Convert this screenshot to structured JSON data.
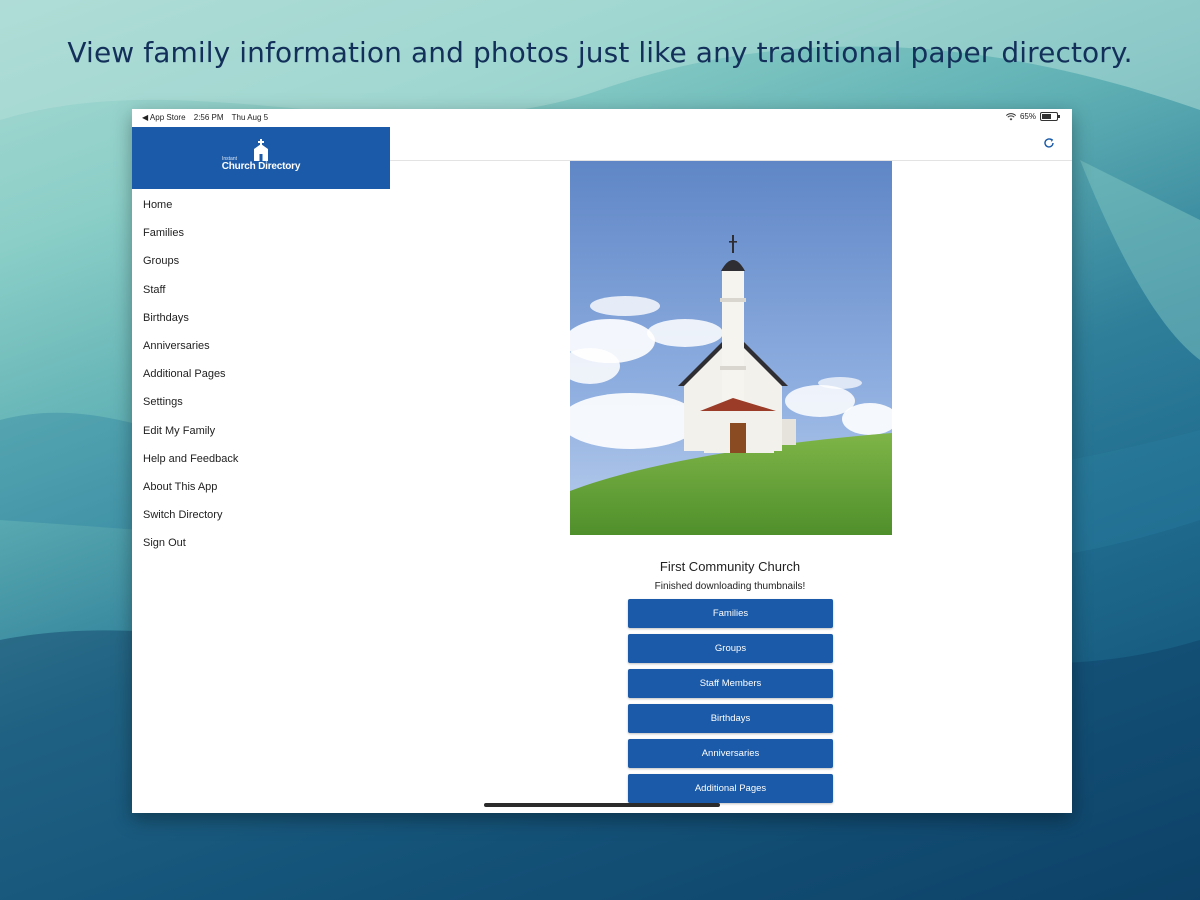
{
  "headline": "View family information and photos just like any traditional paper directory.",
  "status_bar": {
    "back_app": "◀ App Store",
    "time": "2:56 PM",
    "date": "Thu Aug 5",
    "battery": "65%"
  },
  "brand": {
    "top_text": "Instant",
    "name": "Church Directory"
  },
  "menu": [
    {
      "label": "Home"
    },
    {
      "label": "Families"
    },
    {
      "label": "Groups"
    },
    {
      "label": "Staff"
    },
    {
      "label": "Birthdays"
    },
    {
      "label": "Anniversaries"
    },
    {
      "label": "Additional Pages"
    },
    {
      "label": "Settings"
    },
    {
      "label": "Edit My Family"
    },
    {
      "label": "Help and Feedback"
    },
    {
      "label": "About This App"
    },
    {
      "label": "Switch Directory"
    },
    {
      "label": "Sign Out"
    }
  ],
  "main": {
    "church_name": "First Community Church",
    "status_message": "Finished downloading thumbnails!",
    "buttons": [
      {
        "label": "Families"
      },
      {
        "label": "Groups"
      },
      {
        "label": "Staff Members"
      },
      {
        "label": "Birthdays"
      },
      {
        "label": "Anniversaries"
      },
      {
        "label": "Additional Pages"
      }
    ]
  },
  "colors": {
    "brand_blue": "#1a5aa8",
    "headline": "#13305a"
  },
  "icons": {
    "refresh": "refresh-icon",
    "wifi": "wifi-icon",
    "battery": "battery-icon"
  }
}
